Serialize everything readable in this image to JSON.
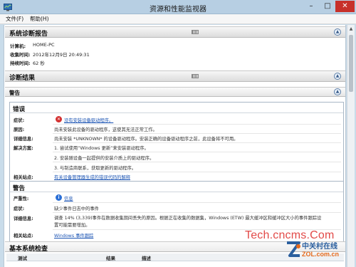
{
  "window": {
    "title": "资源和性能监视器"
  },
  "menu": {
    "file": "文件(F)",
    "help": "帮助(H)"
  },
  "report": {
    "title": "系统诊断报告",
    "computer_label": "计算机:",
    "computer_value": "HOME-PC",
    "collected_label": "收集时间:",
    "collected_value": "2012年12月9日 20:49:31",
    "duration_label": "持续时间:",
    "duration_value": "62 秒"
  },
  "diagnostics": {
    "title": "诊断结果"
  },
  "warnings_section": {
    "title": "警告"
  },
  "error": {
    "title": "错误",
    "symptom_label": "症状:",
    "symptom_value": "没有安装设备驱动程序。",
    "cause_label": "原因:",
    "cause_value": "尚未安装此设备的驱动程序，这使其无法正常工作。",
    "details_label": "详细信息:",
    "details_value": "尚未安装 *UNKNOWN* 的设备驱动程序。安装正确的设备驱动程序之前，此设备将不可用。",
    "solution_label": "解决方案:",
    "solutions": [
      "1. 尝试使用“Windows 更新”来安装驱动程序。",
      "2. 安装随设备一起提供的安装介质上的驱动程序。",
      "3. 与制造商联系，获取更新的驱动程序。"
    ],
    "related_label": "相关站点:",
    "related_link": "有关设备管理器生成的错误代码的解释"
  },
  "warning": {
    "title": "警告",
    "severity_label": "严重性:",
    "severity_value": "信息",
    "symptom_label": "症状:",
    "symptom_value": "缺少事件日志中的事件",
    "details_label": "详细信息:",
    "details_line1": "调查 14% (3,339)事件在数据收集期间丢失的原因。根据正在收集的数据集，Windows (ETW) 最大缓冲区和缓冲区大小的事件跟踪设",
    "details_line2": "置可能需要增加。",
    "related_label": "相关站点:",
    "related_link": "Windows 事件跟踪"
  },
  "basic_checks": {
    "title": "基本系统检查",
    "columns": [
      "测试",
      "结果",
      "描述"
    ]
  },
  "watermark": {
    "text": "Tech.cncms.Com",
    "logo_cn": "中关村在线",
    "logo_en": "ZOL.com.cn"
  },
  "colors": {
    "close_button": "#c7302a",
    "link": "#1a53b3",
    "error_icon": "#d32f2f"
  }
}
